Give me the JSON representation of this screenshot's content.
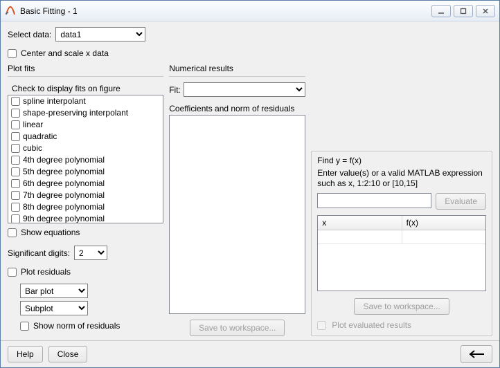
{
  "window": {
    "title": "Basic Fitting - 1"
  },
  "select_data": {
    "label": "Select data:",
    "value": "data1"
  },
  "center_scale": {
    "label": "Center and scale x data",
    "checked": false
  },
  "plot_fits": {
    "title": "Plot fits",
    "subtitle": "Check to display fits on figure",
    "items": [
      "spline interpolant",
      "shape-preserving interpolant",
      "linear",
      "quadratic",
      "cubic",
      "4th degree polynomial",
      "5th degree polynomial",
      "6th degree polynomial",
      "7th degree polynomial",
      "8th degree polynomial",
      "9th degree polynomial"
    ],
    "show_equations": {
      "label": "Show equations",
      "checked": false
    },
    "sig_digits": {
      "label": "Significant digits:",
      "value": "2"
    },
    "plot_residuals": {
      "label": "Plot residuals",
      "checked": false
    },
    "residual_type": "Bar plot",
    "residual_loc": "Subplot",
    "show_norm": {
      "label": "Show norm of residuals",
      "checked": false
    }
  },
  "numerical": {
    "title": "Numerical results",
    "fit_label": "Fit:",
    "coef_label": "Coefficients and norm of residuals",
    "save_ws": "Save to workspace..."
  },
  "find": {
    "title": "Find y = f(x)",
    "instr": "Enter value(s) or a valid MATLAB expression such as x, 1:2:10 or [10,15]",
    "evaluate": "Evaluate",
    "col_x": "x",
    "col_fx": "f(x)",
    "save_ws": "Save to workspace...",
    "plot_eval": "Plot evaluated results"
  },
  "buttons": {
    "help": "Help",
    "close": "Close"
  }
}
